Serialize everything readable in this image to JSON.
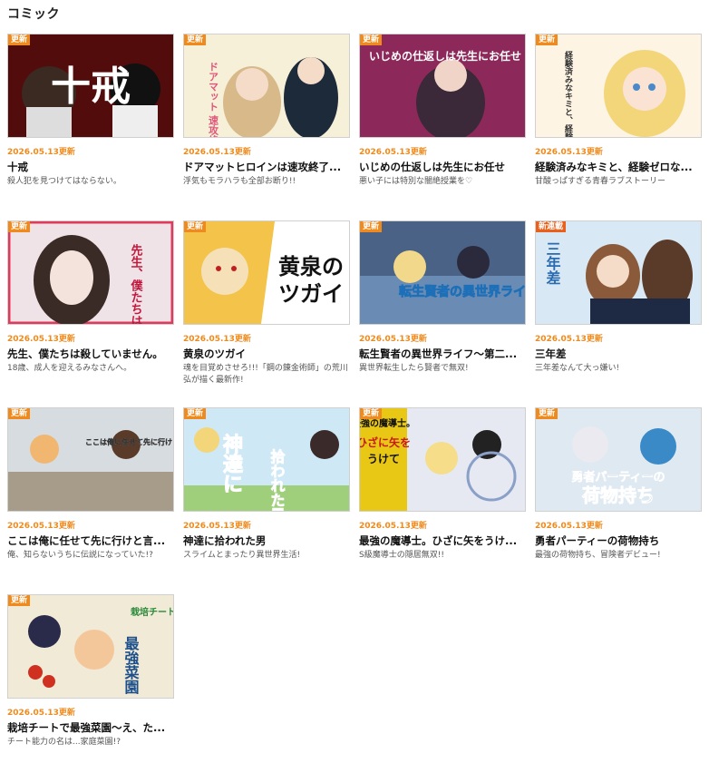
{
  "section": {
    "title": "コミック"
  },
  "colors": {
    "accent": "#f08a1d",
    "badge_new_series": "#e8601c"
  },
  "comics": [
    {
      "badge": "更新",
      "date": "2026.05.13更新",
      "title": "十戒",
      "desc": "殺人犯を見つけてはならない。",
      "art_text": "十戒",
      "art": "jukai"
    },
    {
      "badge": "更新",
      "date": "2026.05.13更新",
      "title": "ドアマットヒロインは速攻終了...",
      "desc": "浮気もモラハラも全部お断り!!",
      "art_text": "ドアマット 速攻終了",
      "art": "doormat"
    },
    {
      "badge": "更新",
      "date": "2026.05.13更新",
      "title": "いじめの仕返しは先生にお任せ",
      "desc": "悪い子には特別な闇絶授業を♡",
      "art_text": "いじめの仕返しは先生にお任せ",
      "art": "ijime"
    },
    {
      "badge": "更新",
      "date": "2026.05.13更新",
      "title": "経験済みなキミと、経験ゼロな...",
      "desc": "甘酸っぱすぎる青春ラブストーリー",
      "art_text": "経験済みなキミと、経験ゼロなオレがお付き合いする話。",
      "art": "keiken"
    },
    {
      "badge": "更新",
      "date": "2026.05.13更新",
      "title": "先生、僕たちは殺していません。",
      "desc": "18歳、成人を迎えるみなさんへ。",
      "art_text": "先生、僕たちは殺していません",
      "art": "sensei"
    },
    {
      "badge": "更新",
      "date": "2026.05.13更新",
      "title": "黄泉のツガイ",
      "desc": "魂を目覚めさせろ!!!「鋼の錬金術師」の荒川弘が描く最新作!",
      "art_text": "黄泉のツガイ",
      "art": "yomi"
    },
    {
      "badge": "更新",
      "date": "2026.05.13更新",
      "title": "転生賢者の異世界ライフ～第二...",
      "desc": "異世界転生したら賢者で無双!",
      "art_text": "転生賢者の異世界ライフ",
      "art": "tensei"
    },
    {
      "badge": "新連載",
      "date": "2026.05.13更新",
      "title": "三年差",
      "desc": "三年差なんて大っ嫌い!",
      "art_text": "三年差",
      "art": "sannen"
    },
    {
      "badge": "更新",
      "date": "2026.05.13更新",
      "title": "ここは俺に任せて先に行けと言...",
      "desc": "俺、知らないうちに伝説になっていた!?",
      "art_text": "ここは俺に任せて先に行けと言ってから伝説になっていた。",
      "art": "kokoha"
    },
    {
      "badge": "更新",
      "date": "2026.05.13更新",
      "title": "神達に拾われた男",
      "desc": "スライムとまったり異世界生活!",
      "art_text": "神達に拾われた男",
      "art": "kami"
    },
    {
      "badge": "更新",
      "date": "2026.05.13更新",
      "title": "最強の魔導士。ひざに矢をうけ...",
      "desc": "S級魔導士の隠居無双!!",
      "art_text": "最強の魔導士。ひざに矢をうけて",
      "art": "madoushi"
    },
    {
      "badge": "更新",
      "date": "2026.05.13更新",
      "title": "勇者パーティーの荷物持ち",
      "desc": "最強の荷物持ち、冒険者デビュー!",
      "art_text": "勇者パーティーの荷物持ち",
      "art": "nimotsu"
    },
    {
      "badge": "更新",
      "date": "2026.05.13更新",
      "title": "栽培チートで最強菜園～え、た...",
      "desc": "チート能力の名は...家庭菜園!?",
      "art_text": "栽培チートで最強菜園",
      "art": "saibai"
    }
  ]
}
